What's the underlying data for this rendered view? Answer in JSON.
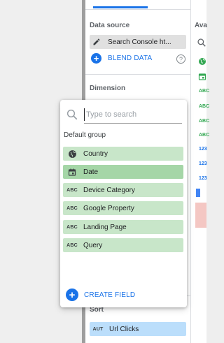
{
  "properties": {
    "data_source_label": "Data source",
    "data_source_value": "Search Console ht...",
    "blend_label": "BLEND DATA",
    "dimension_label": "Dimension",
    "sort_label": "Sort",
    "sort_type": "AUT",
    "sort_value": "Url Clicks"
  },
  "available_fields": {
    "label": "Ava",
    "tags": [
      "ABC",
      "ABC",
      "ABC",
      "ABC",
      "123",
      "123",
      "123"
    ]
  },
  "field_picker": {
    "search_placeholder": "Type to search",
    "group_label": "Default group",
    "fields": [
      {
        "label": "Country",
        "icon": "globe-icon"
      },
      {
        "label": "Date",
        "icon": "calendar-icon"
      },
      {
        "label": "Device Category",
        "icon": "abc",
        "tag": "ABC"
      },
      {
        "label": "Google Property",
        "icon": "abc",
        "tag": "ABC"
      },
      {
        "label": "Landing Page",
        "icon": "abc",
        "tag": "ABC"
      },
      {
        "label": "Query",
        "icon": "abc",
        "tag": "ABC"
      }
    ],
    "selected_index": 1,
    "create_field_label": "CREATE FIELD"
  },
  "colors": {
    "accent": "#1a73e8",
    "dimension_chip": "#c8e6c9",
    "dimension_chip_selected": "#a5d6a7",
    "metric_chip": "#bbdefb",
    "dimension_text": "#34a853",
    "metric_text": "#1a73e8"
  }
}
